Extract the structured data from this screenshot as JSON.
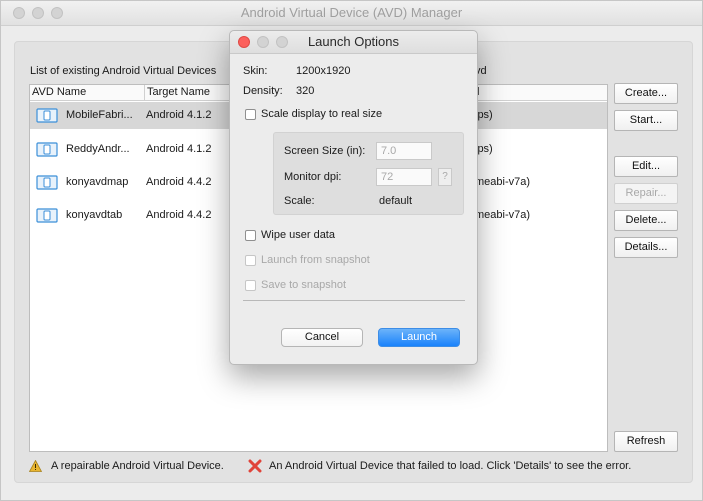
{
  "window": {
    "title": "Android Virtual Device (AVD) Manager"
  },
  "list": {
    "title": "List of existing Android Virtual Devices",
    "title_right_fragment": "vd",
    "columns": [
      "AVD Name",
      "Target Name",
      "l"
    ],
    "rows": [
      {
        "name": "MobileFabri...",
        "target": "Android 4.1.2",
        "abi": "ips)"
      },
      {
        "name": "ReddyAndr...",
        "target": "Android 4.1.2",
        "abi": "ips)"
      },
      {
        "name": "konyavdmap",
        "target": "Android 4.4.2",
        "abi": "meabi-v7a)"
      },
      {
        "name": "konyavdtab",
        "target": "Android 4.4.2",
        "abi": "meabi-v7a)"
      }
    ],
    "selected_row": 0
  },
  "buttons": {
    "create": "Create...",
    "start": "Start...",
    "edit": "Edit...",
    "repair": "Repair...",
    "delete": "Delete...",
    "details": "Details...",
    "refresh": "Refresh"
  },
  "legend": {
    "repairable": "A repairable Android Virtual Device.",
    "failed": "An Android Virtual Device that failed to load. Click 'Details' to see the error."
  },
  "dialog": {
    "title": "Launch Options",
    "skin_label": "Skin:",
    "skin_value": "1200x1920",
    "density_label": "Density:",
    "density_value": "320",
    "scale_label": "Scale display to real size",
    "screen_size_label": "Screen Size (in):",
    "screen_size_value": "7.0",
    "monitor_dpi_label": "Monitor dpi:",
    "monitor_dpi_value": "72",
    "help_label": "?",
    "scale_text_label": "Scale:",
    "scale_text_value": "default",
    "wipe_label": "Wipe user data",
    "launch_snapshot_label": "Launch from snapshot",
    "save_snapshot_label": "Save to snapshot",
    "cancel_label": "Cancel",
    "launch_label": "Launch"
  },
  "colors": {
    "accent_blue": "#1a82fb",
    "close_red": "#fc605c",
    "device_icon_blue": "#3b8fd8",
    "warning_yellow": "#e8b530",
    "error_red": "#e0443a"
  }
}
